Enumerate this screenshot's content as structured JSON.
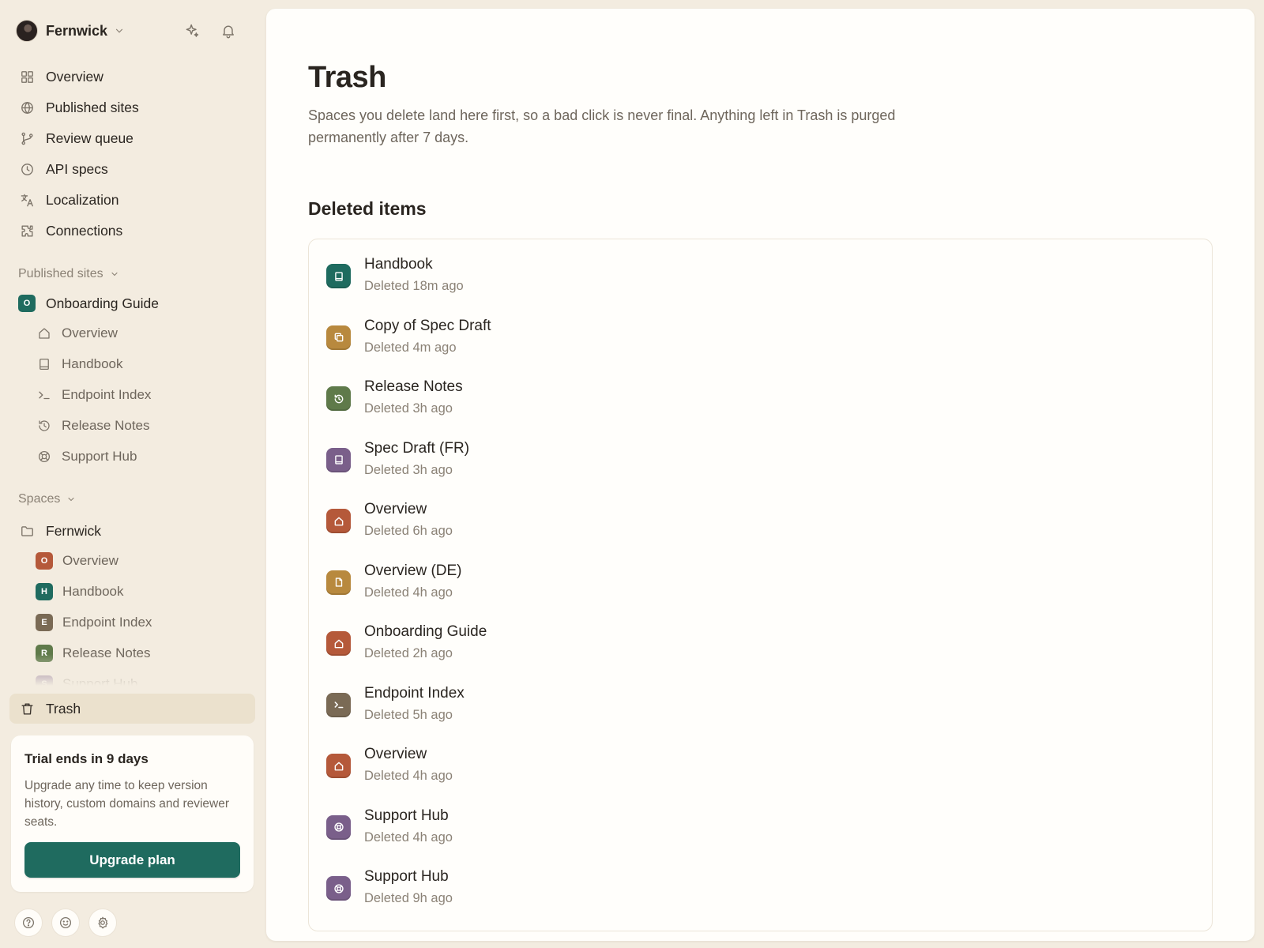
{
  "workspace": {
    "name": "Fernwick"
  },
  "nav": [
    {
      "label": "Overview",
      "icon": "grid-icon"
    },
    {
      "label": "Published sites",
      "icon": "globe-icon"
    },
    {
      "label": "Review queue",
      "icon": "git-branch-icon"
    },
    {
      "label": "API specs",
      "icon": "clock-icon"
    },
    {
      "label": "Localization",
      "icon": "translate-icon"
    },
    {
      "label": "Connections",
      "icon": "puzzle-icon"
    }
  ],
  "published": {
    "label": "Published sites",
    "site": {
      "name": "Onboarding Guide",
      "badge": "O",
      "color": "#1f6b5f"
    },
    "pages": [
      {
        "label": "Overview",
        "icon": "home-icon"
      },
      {
        "label": "Handbook",
        "icon": "book-icon"
      },
      {
        "label": "Endpoint Index",
        "icon": "terminal-icon"
      },
      {
        "label": "Release Notes",
        "icon": "history-icon"
      },
      {
        "label": "Support Hub",
        "icon": "lifebuoy-icon"
      }
    ]
  },
  "spaces": {
    "label": "Spaces",
    "folder": "Fernwick",
    "items": [
      {
        "label": "Overview",
        "badge": "O",
        "color": "#b5593a"
      },
      {
        "label": "Handbook",
        "badge": "H",
        "color": "#1f6b5f"
      },
      {
        "label": "Endpoint Index",
        "badge": "E",
        "color": "#7a6a55"
      },
      {
        "label": "Release Notes",
        "badge": "R",
        "color": "#5f7a4a"
      },
      {
        "label": "Support Hub",
        "badge": "S",
        "color": "#7a5f8a"
      }
    ]
  },
  "trash_nav": {
    "label": "Trash"
  },
  "trial": {
    "title": "Trial ends in 9 days",
    "text": "Upgrade any time to keep version history, custom domains and reviewer seats.",
    "button": "Upgrade plan"
  },
  "page": {
    "title": "Trash",
    "description": "Spaces you delete land here first, so a bad click is never final. Anything left in Trash is purged permanently after 7 days.",
    "section": "Deleted items"
  },
  "deleted": [
    {
      "name": "Handbook",
      "meta": "Deleted 18m ago",
      "icon": "book-icon",
      "color": "#1f6b5f"
    },
    {
      "name": "Copy of Spec Draft",
      "meta": "Deleted 4m ago",
      "icon": "copy-icon",
      "color": "#b8893e"
    },
    {
      "name": "Release Notes",
      "meta": "Deleted 3h ago",
      "icon": "history-icon",
      "color": "#5f7a4a"
    },
    {
      "name": "Spec Draft (FR)",
      "meta": "Deleted 3h ago",
      "icon": "book-icon",
      "color": "#7a5f8a"
    },
    {
      "name": "Overview",
      "meta": "Deleted 6h ago",
      "icon": "home-icon",
      "color": "#b5593a"
    },
    {
      "name": "Overview (DE)",
      "meta": "Deleted 4h ago",
      "icon": "file-icon",
      "color": "#b8893e"
    },
    {
      "name": "Onboarding Guide",
      "meta": "Deleted 2h ago",
      "icon": "home-icon",
      "color": "#b5593a"
    },
    {
      "name": "Endpoint Index",
      "meta": "Deleted 5h ago",
      "icon": "terminal-icon",
      "color": "#7a6a55"
    },
    {
      "name": "Overview",
      "meta": "Deleted 4h ago",
      "icon": "home-icon",
      "color": "#b5593a"
    },
    {
      "name": "Support Hub",
      "meta": "Deleted 4h ago",
      "icon": "lifebuoy-icon",
      "color": "#7a5f8a"
    },
    {
      "name": "Support Hub",
      "meta": "Deleted 9h ago",
      "icon": "lifebuoy-icon",
      "color": "#7a5f8a"
    }
  ],
  "footer_icons": [
    "help-icon",
    "smile-icon",
    "gear-icon"
  ]
}
